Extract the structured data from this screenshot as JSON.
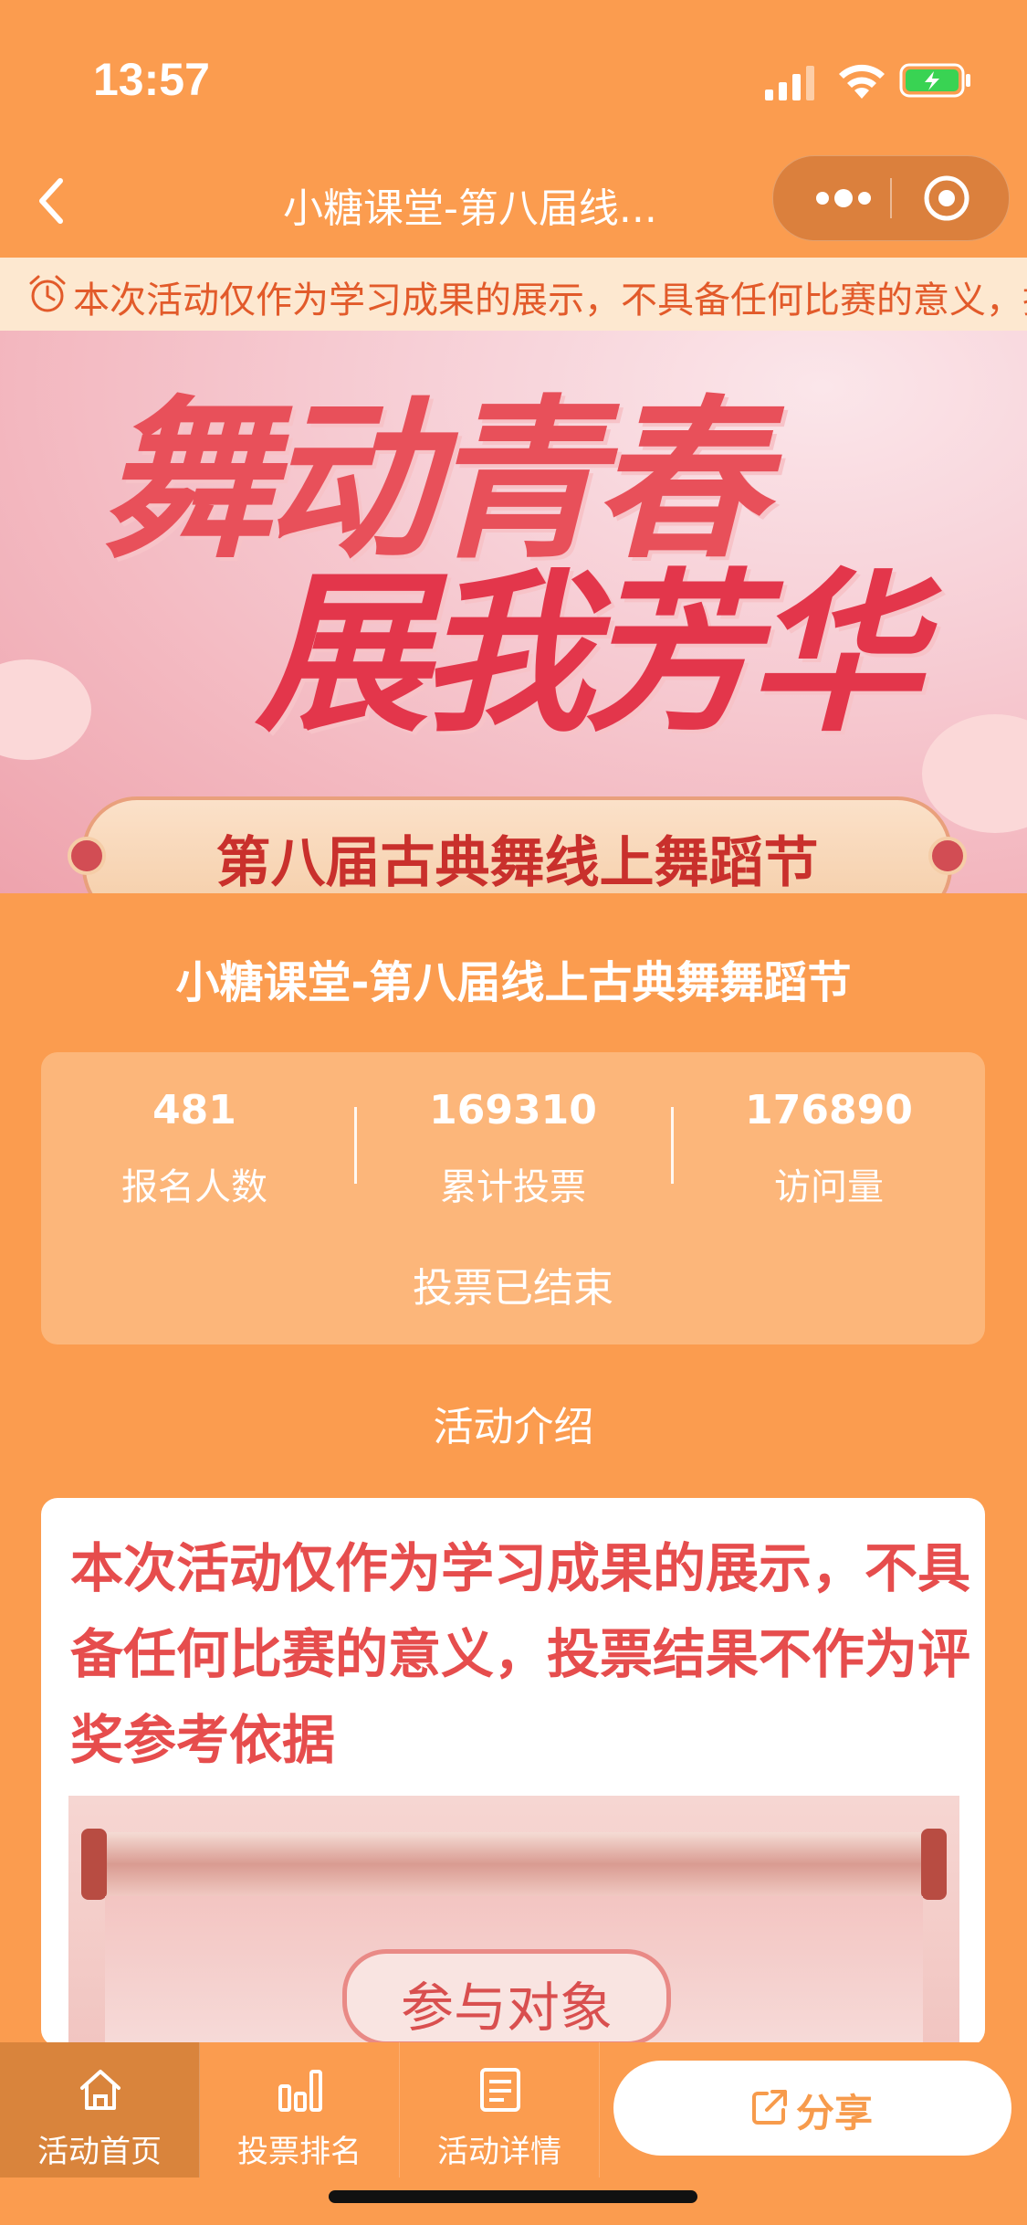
{
  "status_bar": {
    "time": "13:57"
  },
  "nav": {
    "title": "小糖课堂-第八届线..."
  },
  "notice": {
    "text": "本次活动仅作为学习成果的展示，不具备任何比赛的意义，投票结果不作为评奖参考依据"
  },
  "banner": {
    "line1": "舞动青春",
    "line2": "展我芳华",
    "ribbon": "第八届古典舞线上舞蹈节"
  },
  "page_title": "小糖课堂-第八届线上古典舞舞蹈节",
  "stats": [
    {
      "value": "481",
      "label": "报名人数"
    },
    {
      "value": "169310",
      "label": "累计投票"
    },
    {
      "value": "176890",
      "label": "访问量"
    }
  ],
  "vote_status": "投票已结束",
  "section_title": "活动介绍",
  "content": {
    "text": "本次活动仅作为学习成果的展示，不具备任何比赛的意义，投票结果不作为评奖参考依据",
    "scroll_label": "参与对象"
  },
  "tabs": [
    {
      "label": "活动首页",
      "icon": "home-icon"
    },
    {
      "label": "投票排名",
      "icon": "bar-chart-icon"
    },
    {
      "label": "活动详情",
      "icon": "document-icon"
    }
  ],
  "share": {
    "label": "分享",
    "icon": "share-icon"
  },
  "colors": {
    "background": "#fb9c4f",
    "accent": "#e64d4d",
    "stats_card": "#fcb67a"
  }
}
